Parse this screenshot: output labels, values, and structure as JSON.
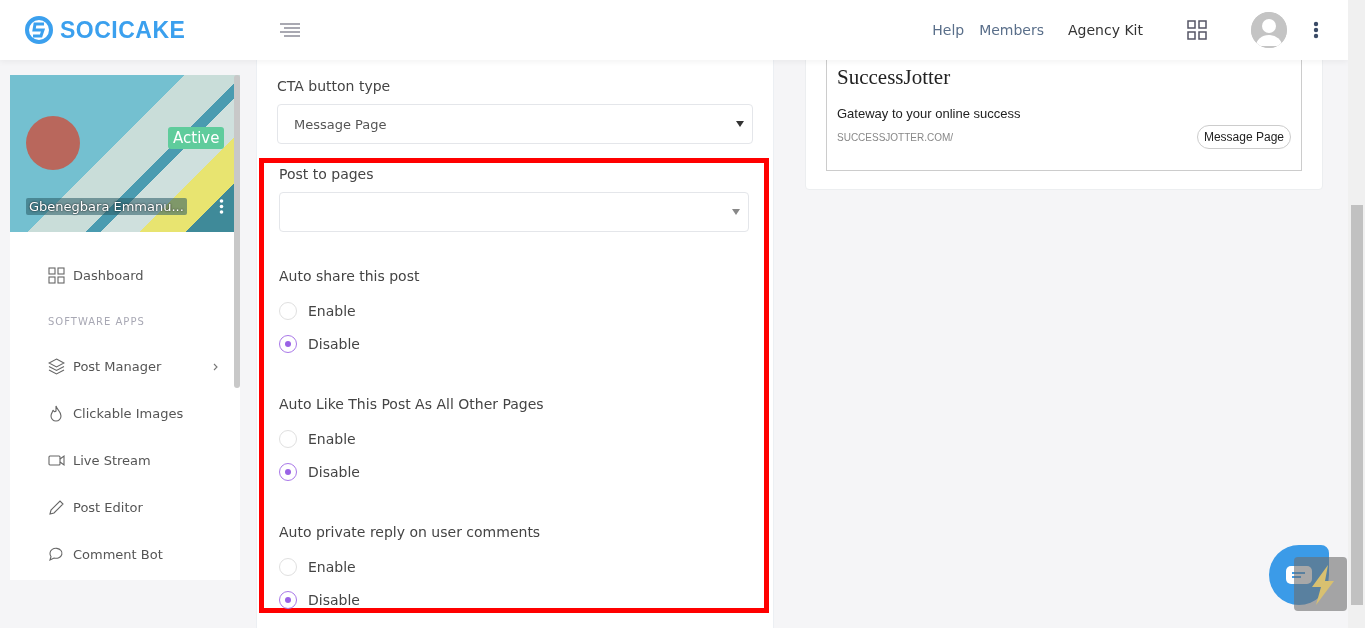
{
  "header": {
    "logo": "SOCICAKE",
    "nav": [
      {
        "label": "Help",
        "emphasis": false
      },
      {
        "label": "Members",
        "emphasis": false
      },
      {
        "label": "Agency Kit",
        "emphasis": true
      }
    ]
  },
  "sidebar": {
    "profile": {
      "name": "Gbenegbara Emmanu...",
      "status": "Active"
    },
    "items": [
      {
        "kind": "item",
        "label": "Dashboard",
        "submenu": false
      },
      {
        "kind": "section",
        "label": "SOFTWARE APPS"
      },
      {
        "kind": "item",
        "label": "Post Manager",
        "submenu": true
      },
      {
        "kind": "item",
        "label": "Clickable Images",
        "submenu": false
      },
      {
        "kind": "item",
        "label": "Live Stream",
        "submenu": false
      },
      {
        "kind": "item",
        "label": "Post Editor",
        "submenu": false
      },
      {
        "kind": "item",
        "label": "Comment Bot",
        "submenu": false
      }
    ]
  },
  "form": {
    "cta": {
      "label": "CTA button type",
      "value": "Message Page"
    },
    "highlighted": {
      "post_to_pages": {
        "label": "Post to pages"
      },
      "groups": [
        {
          "label": "Auto share this post",
          "options": [
            {
              "label": "Enable",
              "selected": false
            },
            {
              "label": "Disable",
              "selected": true
            }
          ]
        },
        {
          "label": "Auto Like This Post As All Other Pages",
          "options": [
            {
              "label": "Enable",
              "selected": false
            },
            {
              "label": "Disable",
              "selected": true
            }
          ]
        },
        {
          "label": "Auto private reply on user comments",
          "options": [
            {
              "label": "Enable",
              "selected": false
            },
            {
              "label": "Disable",
              "selected": true
            }
          ]
        }
      ]
    }
  },
  "preview": {
    "title": "SuccessJotter",
    "description": "Gateway to your online success",
    "url": "SUCCESSJOTTER.COM/",
    "button": "Message Page"
  }
}
